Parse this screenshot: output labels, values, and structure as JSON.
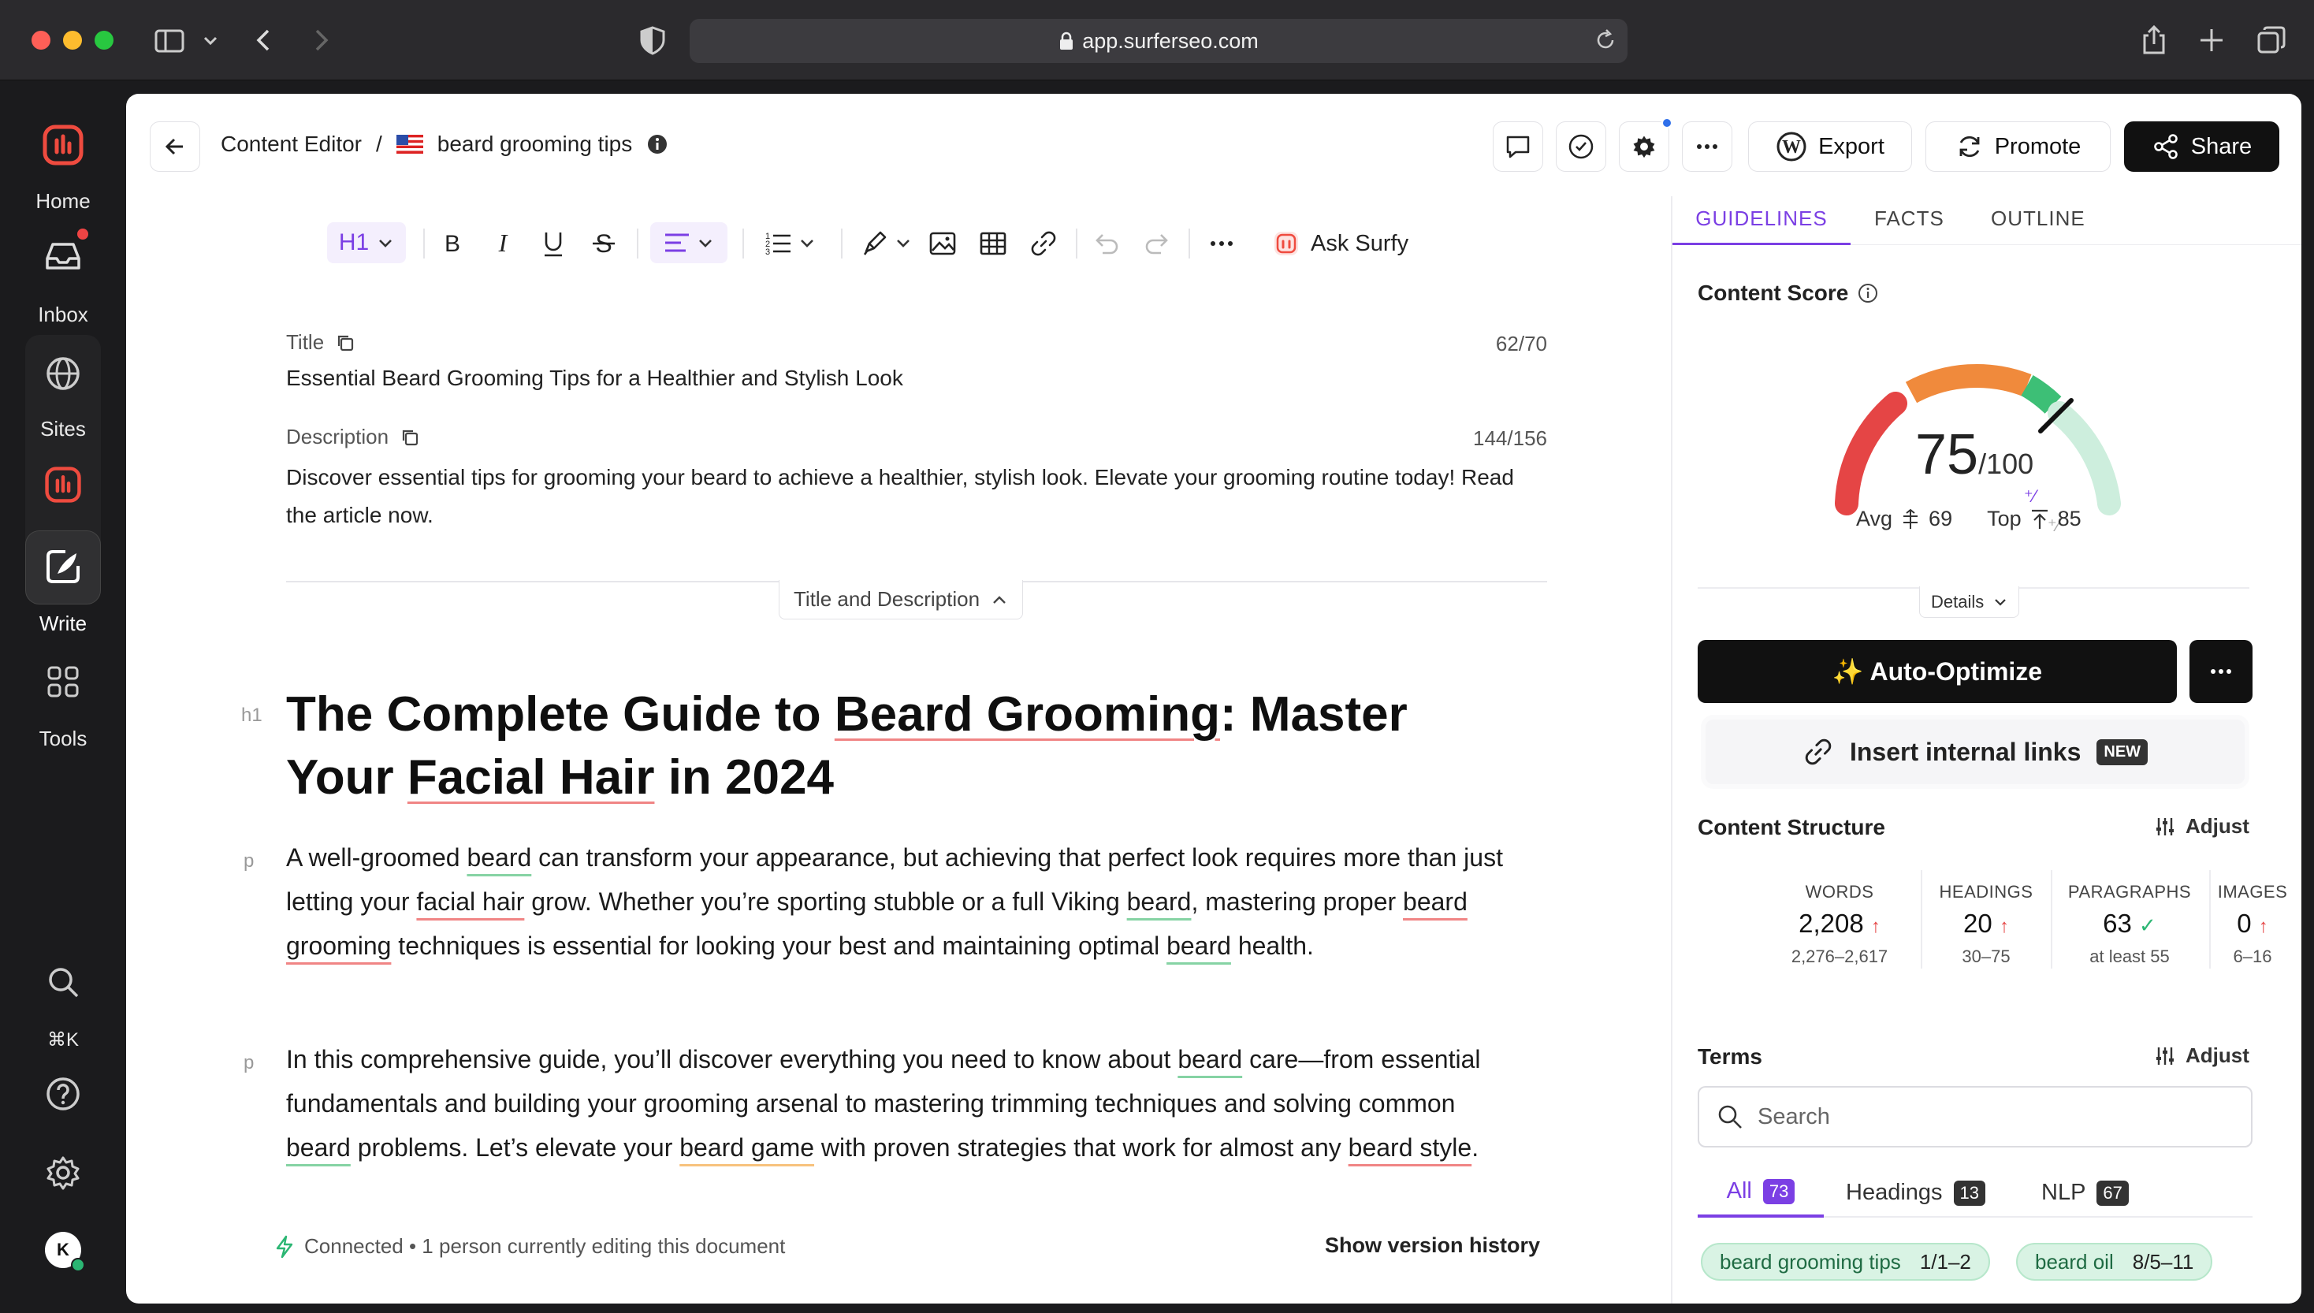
{
  "browser": {
    "url": "app.surferseo.com"
  },
  "nav": {
    "home": "Home",
    "inbox": "Inbox",
    "sites": "Sites",
    "write": "Write",
    "tools": "Tools",
    "shortcut": "⌘K",
    "avatar": "K"
  },
  "header": {
    "breadcrumb_root": "Content Editor",
    "breadcrumb_sep": "/",
    "doc_title": "beard grooming tips",
    "export": "Export",
    "promote": "Promote",
    "share": "Share"
  },
  "toolbar": {
    "heading": "H1",
    "ask_surfy": "Ask Surfy"
  },
  "meta": {
    "title_label": "Title",
    "title_count": "62/70",
    "title_value": "Essential Beard Grooming Tips for a Healthier and Stylish Look",
    "desc_label": "Description",
    "desc_count": "144/156",
    "desc_value": "Discover essential tips for grooming your beard to achieve a healthier, stylish look. Elevate your grooming routine today! Read the article now.",
    "toggle": "Title and Description"
  },
  "article": {
    "h1_marker": "h1",
    "p_marker": "p",
    "h1_a": "The Complete Guide to ",
    "h1_b": "Beard Grooming",
    "h1_c": ": Master",
    "h1_d": "Your ",
    "h1_e": "Facial Hair",
    "h1_f": " in 2024",
    "p1": [
      "A well-groomed ",
      "beard",
      " can transform your appearance, but achieving that perfect look requires more than just letting your ",
      "facial hair",
      " grow. Whether you’re sporting stubble or a full Viking ",
      "beard",
      ", mastering proper ",
      "beard grooming",
      " techniques is essential for looking your best and maintaining optimal ",
      "beard",
      " health."
    ],
    "p2": [
      "In this comprehensive guide, you’ll discover everything you need to know about ",
      "beard",
      " care—from essential fundamentals and building your grooming arsenal to mastering trimming techniques and solving common ",
      "beard",
      " problems. Let’s elevate your ",
      "beard game",
      " with proven strategies that work for almost any ",
      "beard style",
      "."
    ]
  },
  "footer": {
    "status": "Connected • 1 person currently editing this document",
    "history": "Show version history"
  },
  "sidebar": {
    "tabs": [
      "GUIDELINES",
      "FACTS",
      "OUTLINE"
    ],
    "score_label": "Content Score",
    "score": "75",
    "score_max": "/100",
    "avg_label": "Avg",
    "avg": "69",
    "top_label": "Top",
    "top": "85",
    "details": "Details",
    "auto_optimize": "✨ Auto-Optimize",
    "internal_links": "Insert internal links",
    "new_badge": "NEW",
    "structure_label": "Content Structure",
    "adjust": "Adjust",
    "stats": [
      {
        "h": "WORDS",
        "v": "2,208",
        "r": "2,276–2,617"
      },
      {
        "h": "HEADINGS",
        "v": "20",
        "r": "30–75"
      },
      {
        "h": "PARAGRAPHS",
        "v": "63",
        "r": "at least 55"
      },
      {
        "h": "IMAGES",
        "v": "0",
        "r": "6–16"
      }
    ],
    "terms_label": "Terms",
    "search_placeholder": "Search",
    "filter_all": "All",
    "filter_all_count": "73",
    "filter_headings": "Headings",
    "filter_headings_count": "13",
    "filter_nlp": "NLP",
    "filter_nlp_count": "67",
    "chips": [
      {
        "term": "beard grooming tips",
        "count": "1/1–2"
      },
      {
        "term": "beard oil",
        "count": "8/5–11"
      }
    ]
  },
  "colors": {
    "accent": "#7b3fe4",
    "danger": "#e54545",
    "warning": "#f08a3c",
    "success": "#3dbf76",
    "dark": "#151515"
  }
}
